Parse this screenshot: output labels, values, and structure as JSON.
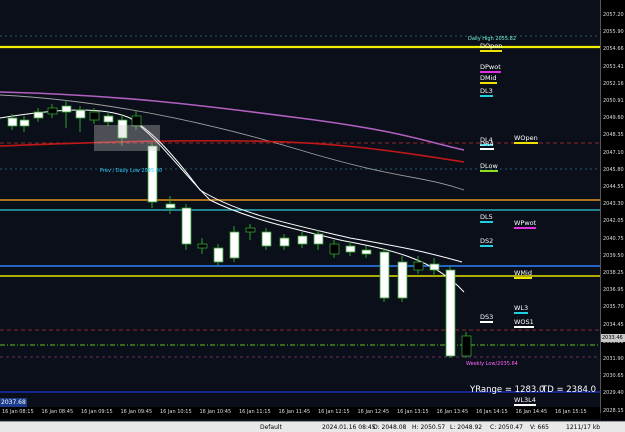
{
  "price_axis": {
    "ticks": [
      "2057.20",
      "2055.90",
      "2054.66",
      "2053.41",
      "2052.16",
      "2050.91",
      "2049.60",
      "2048.35",
      "2047.10",
      "2045.80",
      "2044.55",
      "2043.30",
      "2042.05",
      "2040.75",
      "2039.50",
      "2038.25",
      "2036.95",
      "2035.70",
      "2034.45",
      "2033.20",
      "2031.90",
      "2030.65",
      "2029.40",
      "2028.15"
    ],
    "current_tag": "2033.46",
    "current_tag_color": "#c8c8c8"
  },
  "time_axis": {
    "labels": [
      "16 Jan 08:15",
      "16 Jan 08:45",
      "16 Jan 09:15",
      "16 Jan 09:45",
      "16 Jan 10:15",
      "16 Jan 10:45",
      "16 Jan 11:15",
      "16 Jan 11:45",
      "16 Jan 12:15",
      "16 Jan 12:45",
      "16 Jan 13:15",
      "16 Jan 13:45",
      "16 Jan 14:15",
      "16 Jan 14:45",
      "16 Jan 15:15"
    ]
  },
  "annotations": {
    "daily_high": "Daily High 2055.82",
    "prev_daily_low": "Prev / Daily Low 2045.80",
    "weekly_low": "Weekly Low/2035.64",
    "left_price": "2037.68"
  },
  "levels": [
    {
      "label": "DOpen",
      "color": "#f0e000",
      "text_color": "#ffffff"
    },
    {
      "label": "DPwot",
      "color": "#e030e0",
      "text_color": "#ffffff"
    },
    {
      "label": "DMid",
      "color": "#f0e000",
      "text_color": "#ffffff"
    },
    {
      "label": "DL3",
      "color": "#20d0e0",
      "text_color": "#ffffff"
    },
    {
      "label": "DL4",
      "color": "#20d0e0",
      "text_color": "#ffffff"
    },
    {
      "label": "DR4",
      "color": "#ffffff",
      "text_color": "#ffffff"
    },
    {
      "label": "WOpen",
      "color": "#f0e000",
      "text_color": "#ffffff"
    },
    {
      "label": "DLow",
      "color": "#90e020",
      "text_color": "#ffffff"
    },
    {
      "label": "DL5",
      "color": "#20d0e0",
      "text_color": "#ffffff"
    },
    {
      "label": "WPwot",
      "color": "#e030e0",
      "text_color": "#ffffff"
    },
    {
      "label": "DS2",
      "color": "#20d0e0",
      "text_color": "#ffffff"
    },
    {
      "label": "WMid",
      "color": "#f0e000",
      "text_color": "#ffffff"
    },
    {
      "label": "WL3",
      "color": "#20d0e0",
      "text_color": "#ffffff"
    },
    {
      "label": "DS3",
      "color": "#ffffff",
      "text_color": "#ffffff"
    },
    {
      "label": "WOS1",
      "color": "#ffffff",
      "text_color": "#ffffff"
    },
    {
      "label": "WL3L4",
      "color": "#ffffff",
      "text_color": "#ffffff"
    }
  ],
  "stats": {
    "yrange": "YRange = 1283.0",
    "td": "TD = 2384.0"
  },
  "status_bar": {
    "profile": "Default",
    "datetime": "2024.01.16 08:45",
    "open": "O: 2048.08",
    "high": "H: 2050.57",
    "low": "L: 2048.92",
    "close": "C: 2050.47",
    "volume": "V: 665",
    "traffic": "1211/17 kb"
  },
  "colors": {
    "background": "#0b0f19",
    "bull": "#ffffff",
    "bear": "#000000",
    "wick": "#2fa02f",
    "ma_fast": "#ffffff",
    "ma_purple": "#b060c0",
    "ma_red": "#c01818",
    "ma_gray": "#a0a0a0",
    "daily_high_line": "#f0f000",
    "orange_line": "#e0901a",
    "cyan_line": "#30c8d8",
    "blue_line": "#3080ff",
    "navy_line": "#1828a0"
  }
}
